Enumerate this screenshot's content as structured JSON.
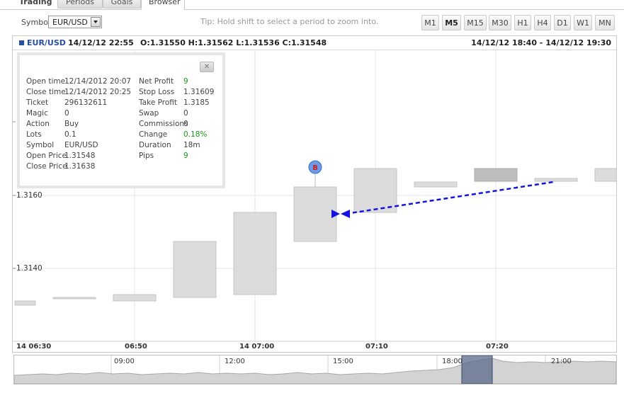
{
  "tabs": [
    {
      "label": "Trading",
      "active": false
    },
    {
      "label": "Periods",
      "active": false
    },
    {
      "label": "Goals",
      "active": false
    },
    {
      "label": "Browser",
      "active": true
    }
  ],
  "toolbar": {
    "symbol_label": "Symbol",
    "symbol_value": "EUR/USD",
    "tip": "Tip: Hold shift to select a period to zoom into.",
    "periods": [
      "M1",
      "M5",
      "M15",
      "M30",
      "H1",
      "H4",
      "D1",
      "W1",
      "MN"
    ],
    "active_period": "M5"
  },
  "chart": {
    "header": {
      "symbol": "EUR/USD",
      "datetime": "14/12/12 22:55",
      "ohlc": "O:1.31550 H:1.31562 L:1.31536 C:1.31548",
      "range": "14/12/12 18:40 - 14/12/12 19:30"
    },
    "price_labels": [
      "1.3160",
      "1.3140"
    ],
    "time_labels": [
      "14 06:30",
      "06:50",
      "14 07:00",
      "07:10",
      "07:20"
    ],
    "marker_label": "B",
    "colors": {
      "candle_fill": "#dcdcdc",
      "candle_dark": "#bdbdbd",
      "trade_line": "#1a1ae6",
      "marker": "#5a8fe0"
    }
  },
  "trade_info": {
    "left": [
      {
        "label": "Open time",
        "value": "12/14/2012 20:07"
      },
      {
        "label": "Close time",
        "value": "12/14/2012 20:25"
      },
      {
        "label": "Ticket",
        "value": "296132611"
      },
      {
        "label": "Magic",
        "value": "0"
      },
      {
        "label": "Action",
        "value": "Buy"
      },
      {
        "label": "Lots",
        "value": "0.1"
      },
      {
        "label": "Symbol",
        "value": "EUR/USD"
      },
      {
        "label": "Open Price",
        "value": "1.31548"
      },
      {
        "label": "Close Price",
        "value": "1.31638"
      }
    ],
    "right": [
      {
        "label": "Net Profit",
        "value": "9",
        "green": true
      },
      {
        "label": "Stop Loss",
        "value": "1.31609"
      },
      {
        "label": "Take Profit",
        "value": "1.3185"
      },
      {
        "label": "Swap",
        "value": "0"
      },
      {
        "label": "Commissions",
        "value": "0"
      },
      {
        "label": "Change",
        "value": "0.18%",
        "green": true
      },
      {
        "label": "Duration",
        "value": "18m"
      },
      {
        "label": "Pips",
        "value": "9",
        "green": true
      }
    ],
    "close_glyph": "✕"
  },
  "navigator": {
    "time_labels": [
      "09:00",
      "12:00",
      "15:00",
      "18:00",
      "21:00"
    ]
  }
}
